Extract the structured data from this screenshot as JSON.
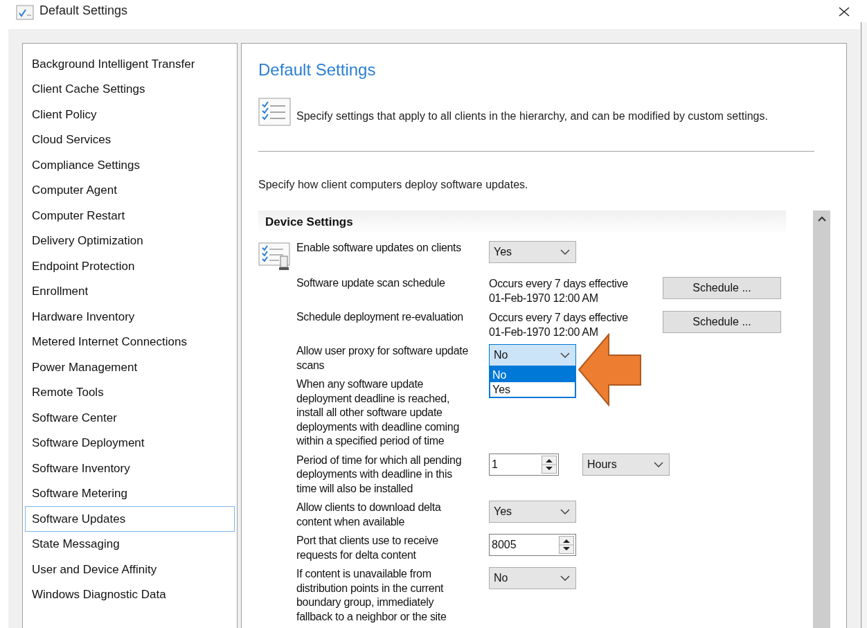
{
  "window": {
    "title": "Default Settings"
  },
  "sidebar": {
    "items": [
      {
        "label": "Background Intelligent Transfer",
        "selected": false
      },
      {
        "label": "Client Cache Settings",
        "selected": false
      },
      {
        "label": "Client Policy",
        "selected": false
      },
      {
        "label": "Cloud Services",
        "selected": false
      },
      {
        "label": "Compliance Settings",
        "selected": false
      },
      {
        "label": "Computer Agent",
        "selected": false
      },
      {
        "label": "Computer Restart",
        "selected": false
      },
      {
        "label": "Delivery Optimization",
        "selected": false
      },
      {
        "label": "Endpoint Protection",
        "selected": false
      },
      {
        "label": "Enrollment",
        "selected": false
      },
      {
        "label": "Hardware Inventory",
        "selected": false
      },
      {
        "label": "Metered Internet Connections",
        "selected": false
      },
      {
        "label": "Power Management",
        "selected": false
      },
      {
        "label": "Remote Tools",
        "selected": false
      },
      {
        "label": "Software Center",
        "selected": false
      },
      {
        "label": "Software Deployment",
        "selected": false
      },
      {
        "label": "Software Inventory",
        "selected": false
      },
      {
        "label": "Software Metering",
        "selected": false
      },
      {
        "label": "Software Updates",
        "selected": true
      },
      {
        "label": "State Messaging",
        "selected": false
      },
      {
        "label": "User and Device Affinity",
        "selected": false
      },
      {
        "label": "Windows Diagnostic Data",
        "selected": false
      }
    ]
  },
  "content": {
    "heading": "Default Settings",
    "description": "Specify settings that apply to all clients in the hierarchy, and can be modified by custom settings.",
    "intro": "Specify how client computers deploy software updates.",
    "section": {
      "title": "Device Settings",
      "rows": [
        {
          "kind": "select",
          "label": "Enable software updates on clients",
          "value": "Yes"
        },
        {
          "kind": "schedule",
          "label": "Software update scan schedule",
          "schedule": "Occurs every 7 days effective 01-Feb-1970 12:00 AM",
          "button": "Schedule ..."
        },
        {
          "kind": "schedule",
          "label": "Schedule deployment re-evaluation",
          "schedule": "Occurs every 7 days effective 01-Feb-1970 12:00 AM",
          "button": "Schedule ..."
        },
        {
          "kind": "select",
          "label": "Allow user proxy for software update scans",
          "value": "No",
          "expanded": true,
          "options": [
            {
              "label": "No",
              "selected": true
            },
            {
              "label": "Yes",
              "selected": false
            }
          ]
        },
        {
          "kind": "text",
          "label": "When any software update deployment deadline is reached, install all other software update deployments with deadline coming within a specified period of time"
        },
        {
          "kind": "spin_unit",
          "label": "Period of time for which all pending deployments with deadline in this time will also be installed",
          "value": "1",
          "unit": "Hours"
        },
        {
          "kind": "select",
          "label": "Allow clients to download delta content when available",
          "value": "Yes"
        },
        {
          "kind": "spin",
          "label": "Port that clients use to receive requests for delta content",
          "value": "8005"
        },
        {
          "kind": "select",
          "label": "If content is unavailable from distribution points in the current boundary group, immediately fallback to a neighbor or the site",
          "value": "No"
        }
      ]
    }
  }
}
